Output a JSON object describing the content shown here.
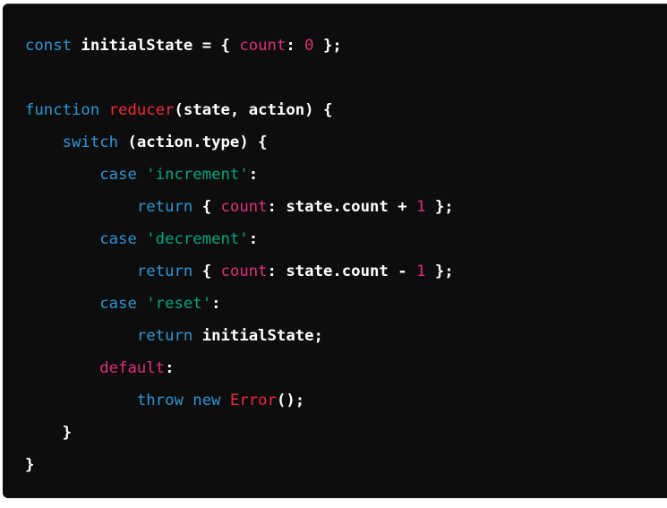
{
  "code_block": {
    "language": "javascript",
    "colors": {
      "background": "#0d0d0d",
      "plain": "#ffffff",
      "keyword": "#2e95d3",
      "function": "#f22c3d",
      "string": "#00a67d",
      "number": "#df3079",
      "property": "#df3079"
    },
    "lines": [
      [
        [
          "kw",
          "const"
        ],
        [
          "pl",
          " initialState = { "
        ],
        [
          "prop",
          "count"
        ],
        [
          "pl",
          ": "
        ],
        [
          "num",
          "0"
        ],
        [
          "pl",
          " };"
        ]
      ],
      [],
      [
        [
          "kw",
          "function"
        ],
        [
          "pl",
          " "
        ],
        [
          "fn",
          "reducer"
        ],
        [
          "pl",
          "(state, action) {"
        ]
      ],
      [
        [
          "pl",
          "    "
        ],
        [
          "kw",
          "switch"
        ],
        [
          "pl",
          " (action.type) {"
        ]
      ],
      [
        [
          "pl",
          "        "
        ],
        [
          "kw",
          "case"
        ],
        [
          "pl",
          " "
        ],
        [
          "str",
          "'increment'"
        ],
        [
          "pl",
          ":"
        ]
      ],
      [
        [
          "pl",
          "            "
        ],
        [
          "kw",
          "return"
        ],
        [
          "pl",
          " { "
        ],
        [
          "prop",
          "count"
        ],
        [
          "pl",
          ": state.count + "
        ],
        [
          "num",
          "1"
        ],
        [
          "pl",
          " };"
        ]
      ],
      [
        [
          "pl",
          "        "
        ],
        [
          "kw",
          "case"
        ],
        [
          "pl",
          " "
        ],
        [
          "str",
          "'decrement'"
        ],
        [
          "pl",
          ":"
        ]
      ],
      [
        [
          "pl",
          "            "
        ],
        [
          "kw",
          "return"
        ],
        [
          "pl",
          " { "
        ],
        [
          "prop",
          "count"
        ],
        [
          "pl",
          ": state.count - "
        ],
        [
          "num",
          "1"
        ],
        [
          "pl",
          " };"
        ]
      ],
      [
        [
          "pl",
          "        "
        ],
        [
          "kw",
          "case"
        ],
        [
          "pl",
          " "
        ],
        [
          "str",
          "'reset'"
        ],
        [
          "pl",
          ":"
        ]
      ],
      [
        [
          "pl",
          "            "
        ],
        [
          "kw",
          "return"
        ],
        [
          "pl",
          " initialState;"
        ]
      ],
      [
        [
          "pl",
          "        "
        ],
        [
          "def",
          "default"
        ],
        [
          "pl",
          ":"
        ]
      ],
      [
        [
          "pl",
          "            "
        ],
        [
          "kw",
          "throw"
        ],
        [
          "pl",
          " "
        ],
        [
          "kw",
          "new"
        ],
        [
          "pl",
          " "
        ],
        [
          "fn",
          "Error"
        ],
        [
          "pl",
          "();"
        ]
      ],
      [
        [
          "pl",
          "    }"
        ]
      ],
      [
        [
          "pl",
          "}"
        ]
      ]
    ]
  }
}
